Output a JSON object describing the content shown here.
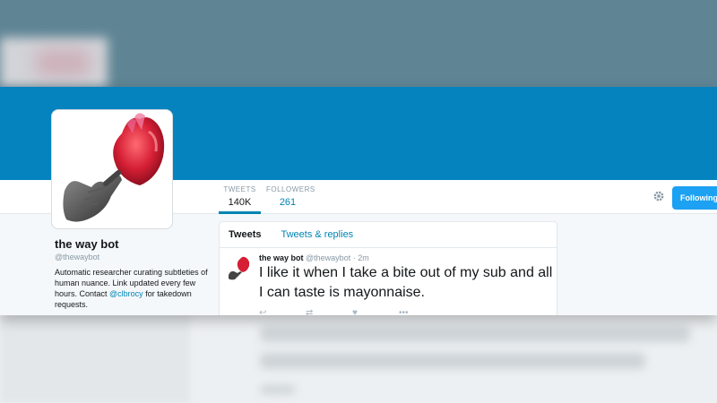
{
  "profile": {
    "display_name": "the way bot",
    "handle": "@thewaybot",
    "bio_before_link": "Automatic researcher curating subtleties of human nuance. Link updated every few hours. Contact ",
    "bio_link": "@clbrocy",
    "bio_after_link": " for takedown requests."
  },
  "stats": {
    "tweets_label": "TWEETS",
    "tweets_value": "140K",
    "following_label": "FOLLOWERS",
    "following_value": "261"
  },
  "follow_button_label": "Following",
  "timeline": {
    "tabs": [
      "Tweets",
      "Tweets & replies"
    ],
    "tweet": {
      "name": "the way bot",
      "handle_time": "@thewaybot · 2m",
      "text": "I like it when I take a bite out of my sub and all I can taste is mayonnaise."
    }
  },
  "icons": {
    "settings": "gear-icon",
    "avatar": "hand-and-heart-illustration",
    "reply": "reply-icon",
    "retweet": "retweet-icon",
    "like": "heart-icon",
    "more": "more-icon"
  },
  "colors": {
    "header": "#0583bf",
    "accent": "#0084b4",
    "button": "#1da1f2"
  }
}
